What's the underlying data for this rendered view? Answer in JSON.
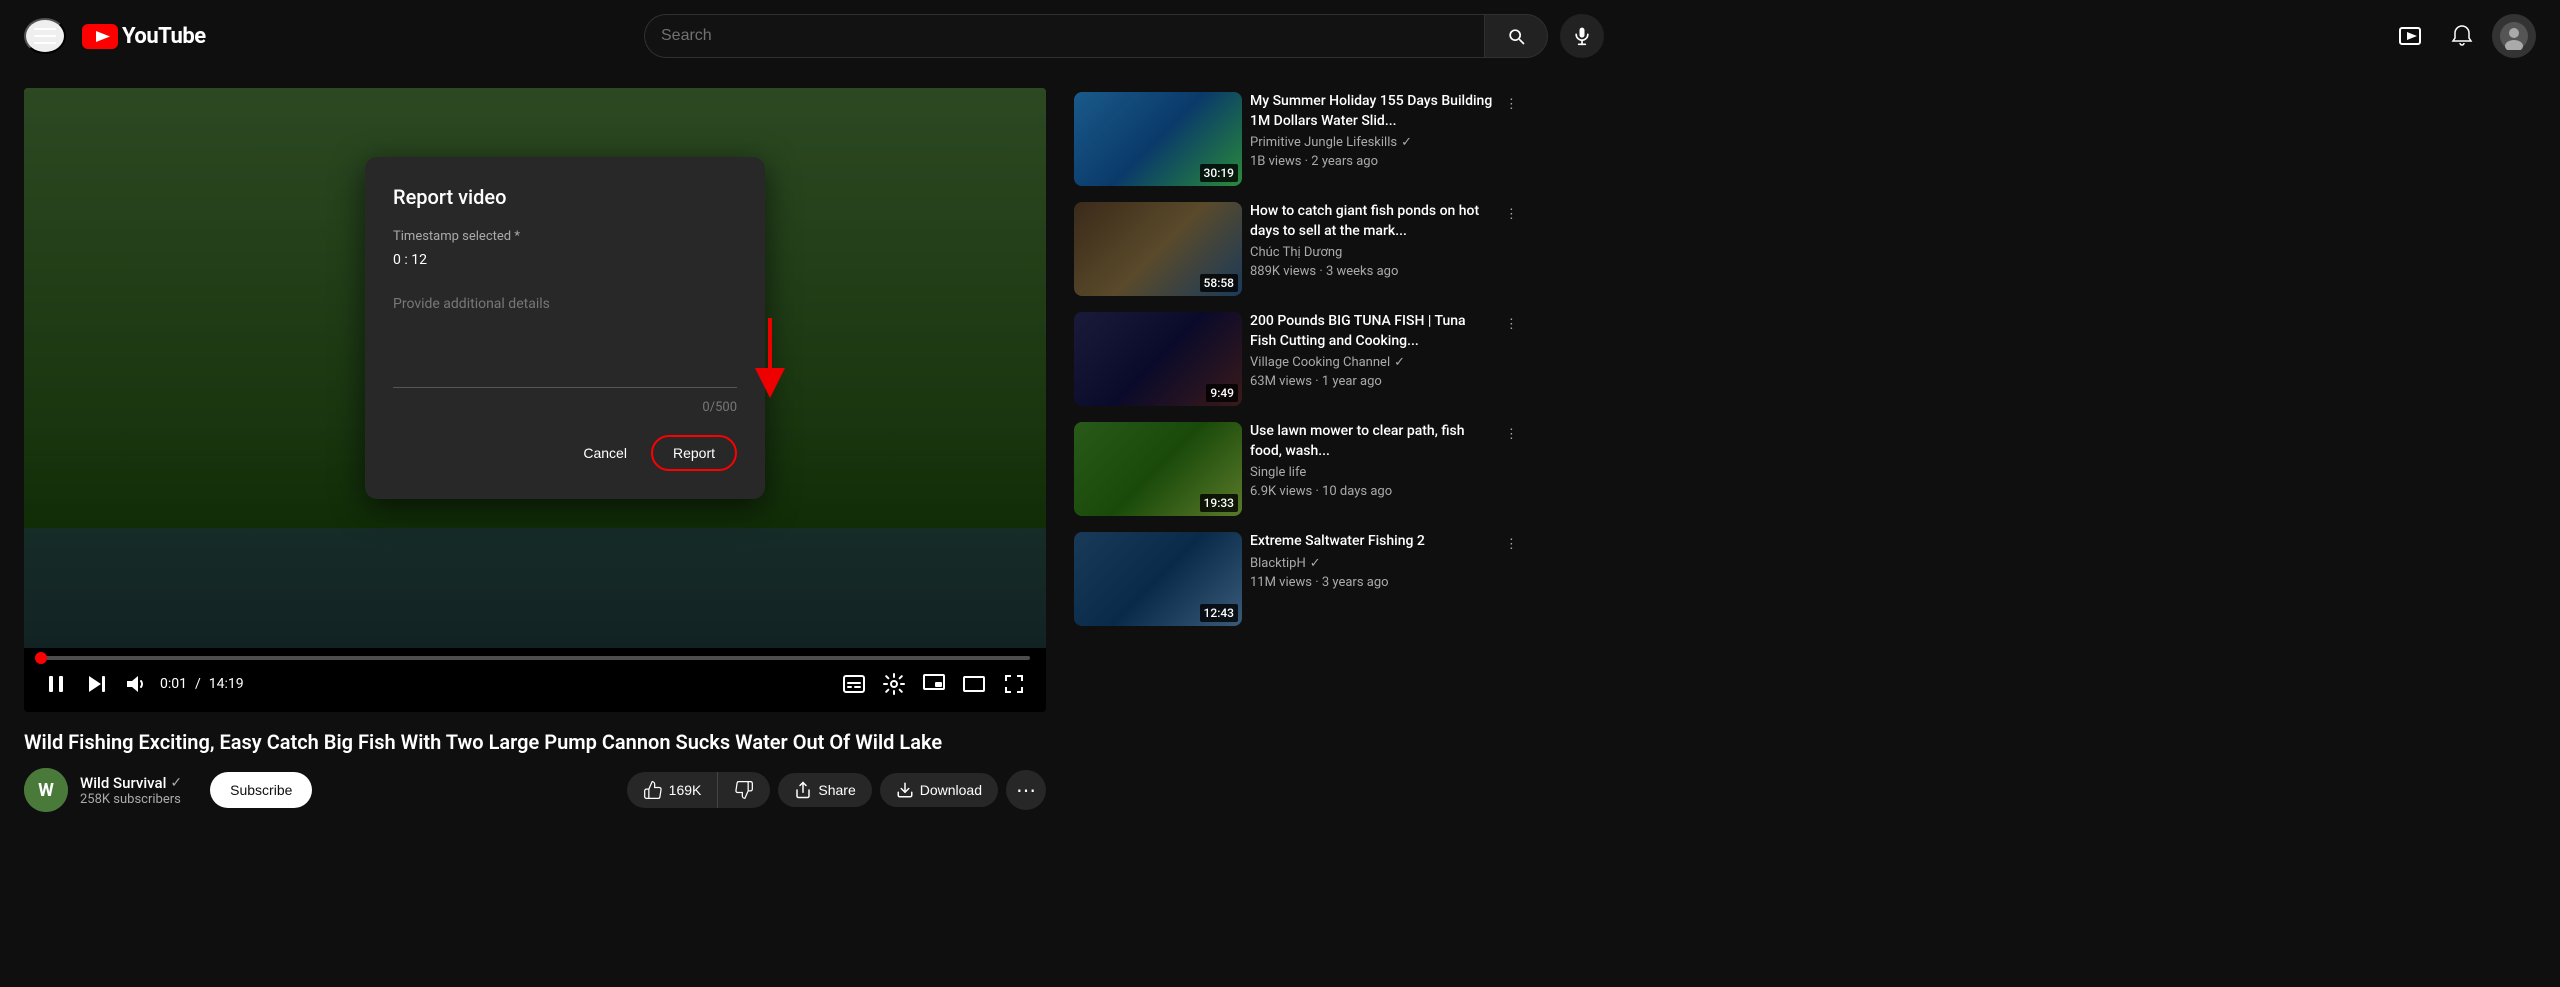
{
  "header": {
    "search_placeholder": "Search",
    "logo_text": "YouTube"
  },
  "video": {
    "title": "Wild Fishing Exciting, Easy Catch Big Fish With Two Large Pump Cannon Sucks Water Out Of Wild Lake",
    "time_current": "0:01",
    "time_total": "14:19",
    "likes": "169K",
    "channel": {
      "name": "Wild Survival",
      "subscribers": "258K subscribers",
      "verified": true
    },
    "subscribe_label": "Subscribe",
    "share_label": "Share",
    "download_label": "Download"
  },
  "report_dialog": {
    "title": "Report video",
    "timestamp_label": "Timestamp selected *",
    "timestamp_value": "0 : 12",
    "textarea_placeholder": "Provide additional details",
    "char_count": "0/500",
    "cancel_label": "Cancel",
    "report_label": "Report"
  },
  "sidebar": {
    "videos": [
      {
        "title": "My Summer Holiday 155 Days Building 1M Dollars Water Slid...",
        "channel": "Primitive Jungle Lifeskills",
        "verified": true,
        "views": "1B views",
        "time_ago": "2 years ago",
        "duration": "30:19",
        "thumb_class": "thumb-1"
      },
      {
        "title": "How to catch giant fish ponds on hot days to sell at the mark...",
        "channel": "Chúc Thị Dương",
        "verified": false,
        "views": "889K views",
        "time_ago": "3 weeks ago",
        "duration": "58:58",
        "thumb_class": "thumb-2"
      },
      {
        "title": "200 Pounds BIG TUNA FISH | Tuna Fish Cutting and Cooking...",
        "channel": "Village Cooking Channel",
        "verified": true,
        "views": "63M views",
        "time_ago": "1 year ago",
        "duration": "9:49",
        "thumb_class": "thumb-3"
      },
      {
        "title": "Use lawn mower to clear path, fish food, wash...",
        "channel": "Single life",
        "verified": false,
        "views": "6.9K views",
        "time_ago": "10 days ago",
        "duration": "19:33",
        "thumb_class": "thumb-4"
      },
      {
        "title": "Extreme Saltwater Fishing 2",
        "channel": "BlacktipH",
        "verified": true,
        "views": "11M views",
        "time_ago": "3 years ago",
        "duration": "12:43",
        "thumb_class": "thumb-5"
      }
    ]
  }
}
